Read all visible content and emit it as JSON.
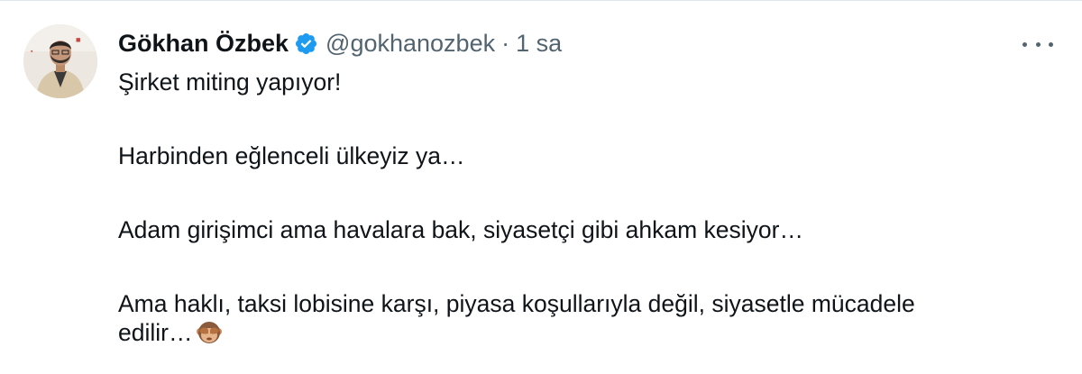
{
  "author": {
    "name": "Gökhan Özbek",
    "handle": "@gokhanozbek",
    "separator": "·",
    "time": "1 sa"
  },
  "icons": {
    "verified": "verified-badge-icon",
    "more": "more-options-icon",
    "emoji": "see-no-evil-monkey-emoji"
  },
  "colors": {
    "text": "#0f1419",
    "muted": "#536471",
    "verified": "#1d9bf0"
  },
  "tweet": {
    "line1": "Şirket miting yapıyor!",
    "line2": "Harbinden eğlenceli ülkeyiz ya…",
    "line3": "Adam girişimci ama havalara bak, siyasetçi gibi ahkam kesiyor…",
    "line4a": "Ama haklı, taksi lobisine karşı, piyasa koşullarıyla değil, siyasetle mücadele",
    "line4b": "edilir…"
  }
}
